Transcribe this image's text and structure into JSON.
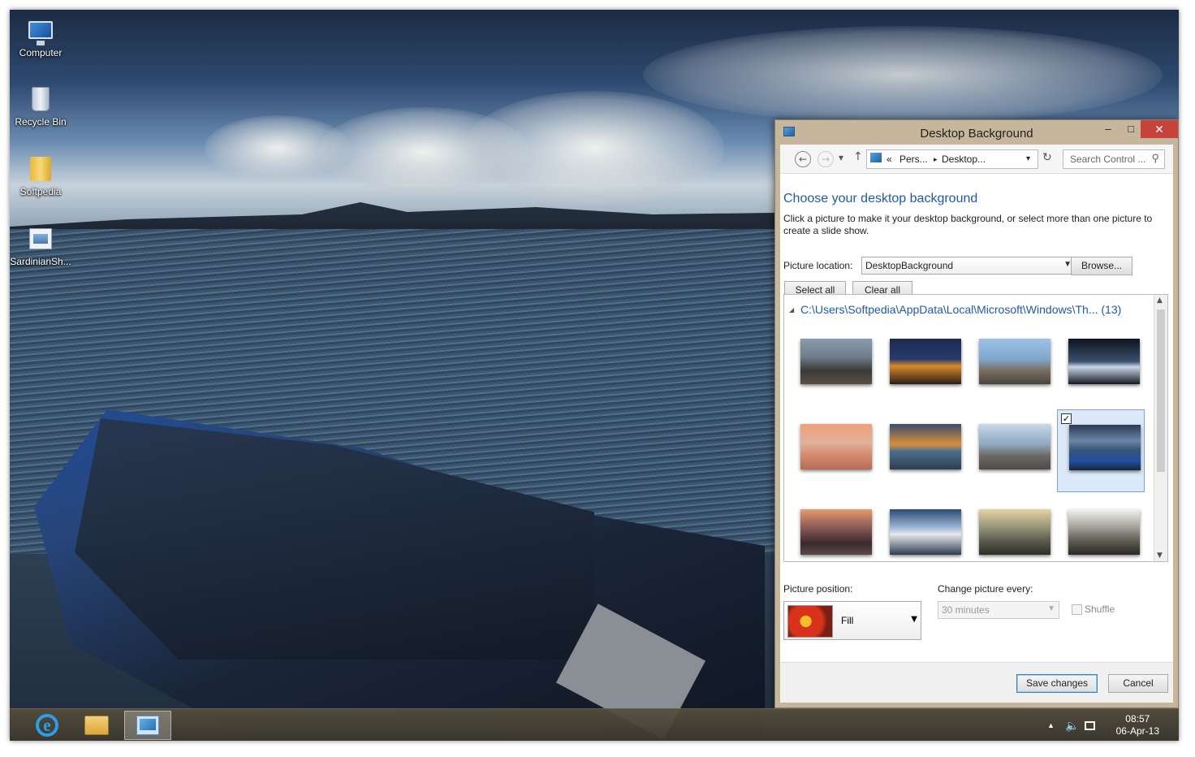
{
  "desktop": {
    "icons": [
      {
        "label": "Computer"
      },
      {
        "label": "Recycle Bin"
      },
      {
        "label": "Softpedia"
      },
      {
        "label": "SardinianSh..."
      }
    ]
  },
  "taskbar": {
    "buttons": [
      {
        "icon": "internet-explorer-icon"
      },
      {
        "icon": "file-explorer-icon"
      },
      {
        "icon": "control-panel-icon"
      }
    ],
    "clock": {
      "time": "08:57",
      "date": "06-Apr-13"
    },
    "tray_up_arrow": "▲"
  },
  "window": {
    "title": "Desktop Background",
    "controls": {
      "minimize": "–",
      "maximize": "□",
      "close": "✕"
    },
    "nav": {
      "back": "←",
      "forward": "→",
      "recent": "▾",
      "up": "↑"
    },
    "address": {
      "chevron": "«",
      "crumb1": "Pers...",
      "sep": "▸",
      "crumb2": "Desktop...",
      "dropdown": "▾",
      "refresh": "↻"
    },
    "search": {
      "placeholder": "Search Control ...",
      "icon": "search-icon"
    },
    "heading": "Choose your desktop background",
    "description": "Click a picture to make it your desktop background, or select more than one picture to create a slide show.",
    "picture_location": {
      "label": "Picture location:",
      "value": "DesktopBackground",
      "browse": "Browse..."
    },
    "select_all": "Select all",
    "clear_all": "Clear all",
    "gallery": {
      "group_header": "C:\\Users\\Softpedia\\AppData\\Local\\Microsoft\\Windows\\Th... (13)",
      "collapse_glyph": "◢",
      "selected_index": 7,
      "thumbnail_count": 12
    },
    "picture_position": {
      "label": "Picture position:",
      "value": "Fill"
    },
    "change_every": {
      "label": "Change picture every:",
      "value": "30 minutes"
    },
    "shuffle": {
      "label": "Shuffle",
      "checked": false
    },
    "save": "Save changes",
    "cancel": "Cancel"
  },
  "colors": {
    "accent": "#1e5aa8",
    "close": "#c7443c",
    "frame": "#c5b69c"
  }
}
